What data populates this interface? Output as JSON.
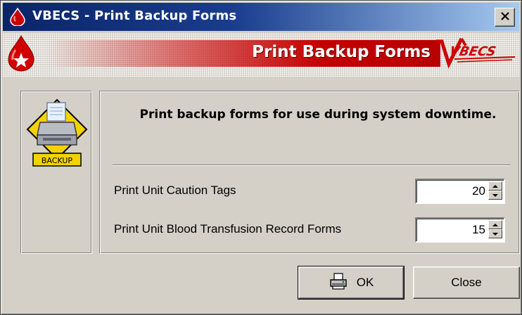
{
  "window": {
    "title": "VBECS - Print Backup Forms"
  },
  "banner": {
    "title": "Print Backup Forms",
    "logo_text": "VBECS"
  },
  "icon_panel": {
    "icon_label": "BACKUP"
  },
  "main": {
    "instruction": "Print backup forms for use during system downtime.",
    "fields": [
      {
        "label": "Print Unit Caution Tags",
        "value": "20"
      },
      {
        "label": "Print Unit Blood Transfusion Record Forms",
        "value": "15"
      }
    ]
  },
  "buttons": {
    "ok_label": "OK",
    "close_label": "Close"
  },
  "colors": {
    "title_bar": "#0a246a",
    "banner_red": "#c40000",
    "face": "#d4d0c8"
  }
}
